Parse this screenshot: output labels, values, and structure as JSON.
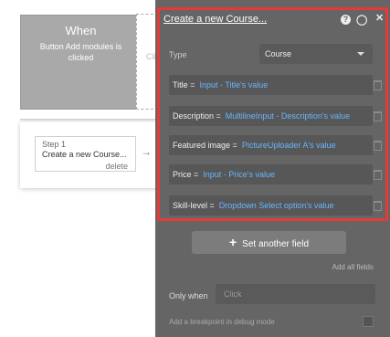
{
  "event": {
    "title": "When",
    "description": "Button Add modules is clicked"
  },
  "ghost": {
    "text": "Cli"
  },
  "step": {
    "number": "Step 1",
    "name": "Create a new Course...",
    "delete_label": "delete",
    "arrow": "→"
  },
  "editor": {
    "title": "Create a new Course...",
    "help_icon": "?",
    "chat_icon": "◯",
    "close_icon": "✕",
    "type_label": "Type",
    "type_value": "Course",
    "fields": [
      {
        "label": "Title =",
        "value": "Input - Title's value"
      },
      {
        "label": "Description =",
        "value": "MultilineInput - Description's value"
      },
      {
        "label": "Featured image =",
        "value": "PictureUploader A's value"
      },
      {
        "label": "Price =",
        "value": "Input - Price's value"
      },
      {
        "label": "Skill-level =",
        "value": "Dropdown Select option's value"
      }
    ],
    "set_field_label": "Set another field",
    "set_field_icon": "+",
    "add_all_label": "Add all fields",
    "only_when_label": "Only when",
    "only_when_placeholder": "Click",
    "debug_label": "Add a breakpoint in debug mode"
  },
  "colors": {
    "highlight": "#e53a37",
    "value_link": "#67b6ff",
    "panel_bg": "#656565",
    "event_bg": "#a9a9a9"
  }
}
